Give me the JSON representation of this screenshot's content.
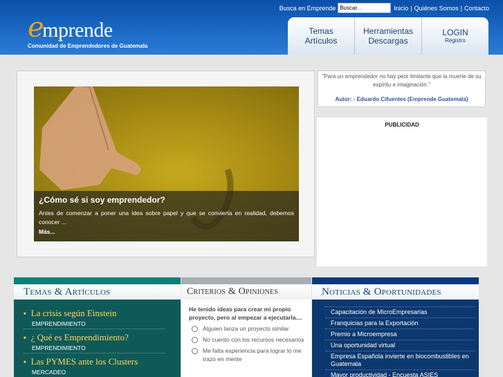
{
  "header": {
    "logo_e": "e",
    "logo_word": "mprende",
    "logo_tagline": "Comunidad de Emprendedores de Guatemala",
    "search_label": "Busca en Emprende",
    "search_value": "Buscar...",
    "links": [
      "Inicio",
      "Quiénes Somos",
      "Contacto"
    ],
    "link_sep": "|"
  },
  "nav": {
    "items": [
      {
        "line1": "Temas",
        "line2": "Artículos"
      },
      {
        "line1": "Herramientas",
        "line2": "Descargas"
      },
      {
        "line1": "LOGIN",
        "line2": "Registro"
      }
    ]
  },
  "slider": {
    "title": "¿Cómo sé si soy emprendedor?",
    "text": "Antes de comenzar a poner una idea sobre papel y que se convierta en realidad, debemos conocer ...",
    "more": "Más..."
  },
  "quote": {
    "text": "\"Para un emprendedor no hay peor limitante que la muerte de su espíritu e imaginación.\"",
    "author": "Autor: - Eduardo Cifuentes (Emprende Guatemala)"
  },
  "ad": {
    "title": "PUBLICIDAD"
  },
  "temas": {
    "title": "Temas & Artículos",
    "items": [
      {
        "title": "La crisis según Einstein",
        "category": "Emprendimiento"
      },
      {
        "title": "¿ Qué es Emprendimiento?",
        "category": "Emprendimiento"
      },
      {
        "title": "Las PYMES ante los Clusters",
        "category": "Mercadeo"
      }
    ]
  },
  "criterios": {
    "title": "Criterios & Opiniones",
    "question": "He tenido ideas para crear mi propio proyecto, pero al empezar a ejecutarla....",
    "options": [
      "Alguien lanza un proyecto similar",
      "No cuento con los recursos necesarios",
      "Me falta experiencia para lograr lo me trazo en mente"
    ]
  },
  "noticias": {
    "title": "Noticias & Oportunidades",
    "items": [
      "Capacitación de MicroEmpresarias",
      "Franquicias para la Exportación",
      "Premio a Microempresa",
      "Una oportunidad virtual",
      "Empresa Española invierte en biocombustibles en Guatemala",
      "Mayor productividad - Encuesta ASIES"
    ]
  }
}
